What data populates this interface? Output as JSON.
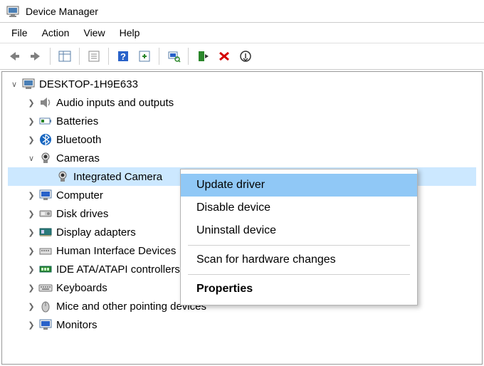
{
  "window": {
    "title": "Device Manager"
  },
  "menu": {
    "file": "File",
    "action": "Action",
    "view": "View",
    "help": "Help"
  },
  "tree": {
    "root": "DESKTOP-1H9E633",
    "nodes": [
      {
        "label": "Audio inputs and outputs",
        "expanded": false
      },
      {
        "label": "Batteries",
        "expanded": false
      },
      {
        "label": "Bluetooth",
        "expanded": false
      },
      {
        "label": "Cameras",
        "expanded": true,
        "children": [
          {
            "label": "Integrated Camera",
            "selected": true
          }
        ]
      },
      {
        "label": "Computer",
        "expanded": false
      },
      {
        "label": "Disk drives",
        "expanded": false
      },
      {
        "label": "Display adapters",
        "expanded": false
      },
      {
        "label": "Human Interface Devices",
        "expanded": false
      },
      {
        "label": "IDE ATA/ATAPI controllers",
        "expanded": false
      },
      {
        "label": "Keyboards",
        "expanded": false
      },
      {
        "label": "Mice and other pointing devices",
        "expanded": false
      },
      {
        "label": "Monitors",
        "expanded": false
      }
    ]
  },
  "context_menu": {
    "update": "Update driver",
    "disable": "Disable device",
    "uninstall": "Uninstall device",
    "scan": "Scan for hardware changes",
    "properties": "Properties"
  }
}
